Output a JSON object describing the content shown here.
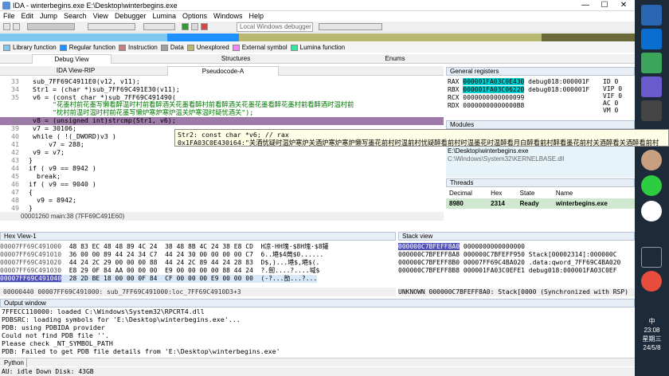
{
  "window": {
    "title": "IDA - winterbegins.exe E:\\Desktop\\winterbegins.exe",
    "controls": [
      "—",
      "☐",
      "✕"
    ]
  },
  "menu": [
    "File",
    "Edit",
    "Jump",
    "Search",
    "View",
    "Debugger",
    "Lumina",
    "Options",
    "Windows",
    "Help"
  ],
  "toolbar": {
    "debugger_combo": "Local Windows debugger"
  },
  "legend": [
    {
      "label": "Library function",
      "color": "#7ec8f0"
    },
    {
      "label": "Regular function",
      "color": "#1e90ff"
    },
    {
      "label": "Instruction",
      "color": "#c08080"
    },
    {
      "label": "Data",
      "color": "#a0a0a0"
    },
    {
      "label": "Unexplored",
      "color": "#b8b870"
    },
    {
      "label": "External symbol",
      "color": "#ff80ff"
    },
    {
      "label": "Lumina function",
      "color": "#40e0a0"
    }
  ],
  "tabs_top": {
    "debug_view": "Debug View",
    "structures": "Structures",
    "enums": "Enums"
  },
  "tabs_code": {
    "ida_view": "IDA View-RIP",
    "pseudocode": "Pseudocode-A"
  },
  "code_lines": [
    {
      "ln": "33",
      "text": "sub_7FF69C4911E0(v12, v11);"
    },
    {
      "ln": "34",
      "text": "Str1 = (char *)sub_7FF69C491E30(v11);"
    },
    {
      "ln": "35",
      "text": "v6 = (const char *)sub_7FF69C491490("
    },
    {
      "ln": "",
      "text": "     \"花墨村前花墨写懒看醉温时村前看醉酒关花墨看醉村前看醉酒关花墨花墨看醉花墨村前看醉酒时温村前"
    },
    {
      "ln": "",
      "text": "     \"枕村前温时温时村前花墨写懒炉寒炉寒炉温关炉寒温时疑忧酒关\");"
    },
    {
      "ln": "38",
      "text": "v8 = (unsigned int)strcmp(Str1, v6);"
    },
    {
      "ln": "39",
      "text": "v7 = 30106;"
    },
    {
      "ln": "40",
      "text": "while ( !(_DWORD)v3 )"
    },
    {
      "ln": "41",
      "text": "  v7 = 288;"
    },
    {
      "ln": "42",
      "text": "v9 = v7;"
    },
    {
      "ln": "43",
      "text": "}"
    },
    {
      "ln": "44",
      "text": "if ( v9 == 8942 )"
    },
    {
      "ln": "45",
      "text": "  break;"
    },
    {
      "ln": "46",
      "text": "if ( v9 == 9040 )"
    },
    {
      "ln": "47",
      "text": "{"
    },
    {
      "ln": "48",
      "text": "  v9 = 8942;"
    },
    {
      "ln": "49",
      "text": "}"
    }
  ],
  "tooltip": {
    "line1": "Str2: const char *v6; // rax",
    "line2": "0x1FA03C0E430i64:\"关酒忧疑时温炉寒炉关酒炉寒炉寒炉懒写墨花前村时温前村忧疑醉看前村时温墨花时温醉看月白醉看前村醉看墨花前村关酒醉看关酒醉看前村"
  },
  "code_status": "00001260 main:38 (7FF69C491E60)",
  "registers": {
    "title": "General registers",
    "rows": [
      {
        "name": "RAX",
        "val": "000001FA03C0E430",
        "info": "debug018:000001F"
      },
      {
        "name": "RBX",
        "val": "000001FA03C06220",
        "info": "debug018:000001F"
      },
      {
        "name": "RCX",
        "val": "0000000000000099",
        "info": ""
      },
      {
        "name": "RDX",
        "val": "00000000000000B8",
        "info": ""
      }
    ],
    "flags": [
      {
        "name": "ID",
        "v": "0"
      },
      {
        "name": "VIP",
        "v": "0"
      },
      {
        "name": "VIF",
        "v": "0"
      },
      {
        "name": "AC",
        "v": "0"
      },
      {
        "name": "VM",
        "v": "0"
      }
    ]
  },
  "modules": {
    "title": "Modules",
    "rows": [
      "E:\\Desktop\\winterbegins.exe",
      "C:\\Windows\\System32\\KERNELBASE.dll"
    ]
  },
  "threads": {
    "title": "Threads",
    "headers": [
      "Decimal",
      "Hex",
      "State",
      "Name"
    ],
    "row": [
      "8980",
      "2314",
      "Ready",
      "winterbegins.exe"
    ]
  },
  "hexview": {
    "title": "Hex View-1",
    "rows": [
      {
        "addr": "00007FF69C491000",
        "bytes": "48 83 EC 48 48 89 4C 24  38 48 8B 4C 24 38 E8 CD",
        "ascii": "H凉·HH塊·$8H塊·$8鑵"
      },
      {
        "addr": "00007FF69C491010",
        "bytes": "36 00 00 89 44 24 34 C7  44 24 30 00 00 00 00 C7",
        "ascii": "6..塂$4菵$0......"
      },
      {
        "addr": "00007FF69C491020",
        "bytes": "44 24 2C 29 00 00 00 88  44 24 2C 89 44 24 28 83",
        "ascii": "D$,)...塂$,塂$(."
      },
      {
        "addr": "00007FF69C491030",
        "bytes": "E8 29 0F 84 AA 00 00 00  E9 00 00 00 00 88 44 24",
        "ascii": "?.劒....?....堿$"
      },
      {
        "addr": "00007FF69C491040",
        "bytes": "28 2D BE 18 00 00 0F 84  CF 00 00 00 E9 00 00 00",
        "ascii": "(-?...勏...?..."
      }
    ],
    "status": "00000440 00007FF69C491000: sub_7FF69C491000:loc_7FF69C4910D3+3"
  },
  "stack": {
    "title": "Stack view",
    "rows": [
      {
        "addr": "000000C7BFEFF8A0",
        "val": "0000000000000000",
        "info": ""
      },
      {
        "addr": "000000C7BFEFF8A8",
        "val": "000000C7BFEFF950",
        "info": "Stack[00002314]:000000C"
      },
      {
        "addr": "000000C7BFEFF8B0",
        "val": "00007FF69C4BA020",
        "info": ".data:qword_7FF69C4BA020"
      },
      {
        "addr": "000000C7BFEFF8B8",
        "val": "000001FA03C0EFE1",
        "info": "debug018:000001FA03C0EF"
      }
    ],
    "status": "UNKNOWN 000000C7BFEFF8A0: Stack[0000 (Synchronized with RSP)"
  },
  "output": {
    "title": "Output window",
    "lines": [
      "7FFECC110000: loaded C:\\Windows\\System32\\RPCRT4.dll",
      "PDBSRC: loading symbols for 'E:\\Desktop\\winterbegins.exe'...",
      "PDB: using PDBIDA provider",
      "Could not find PDB file ''.",
      "Please check _NT_SYMBOL_PATH",
      "PDB: Failed to get PDB file details from 'E:\\Desktop\\winterbegins.exe'"
    ]
  },
  "python_label": "Python",
  "status_bar": "AU:  idle   Down   Disk: 43GB",
  "clock": {
    "time": "23:08",
    "day": "星期三",
    "date": "24/5/8",
    "lang": "中"
  }
}
